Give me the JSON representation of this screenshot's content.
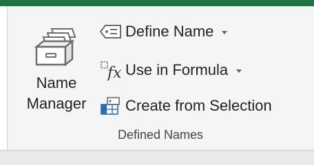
{
  "colors": {
    "accent": "#217346",
    "icon_blue": "#2b6cb0",
    "icon_gray": "#6b6b6b"
  },
  "ribbon_group": {
    "label": "Defined Names",
    "name_manager": {
      "label_line1": "Name",
      "label_line2": "Manager",
      "icon": "name-manager-icon"
    },
    "commands": [
      {
        "label": "Define Name",
        "icon": "define-name-tag-icon",
        "has_dropdown": true
      },
      {
        "label": "Use in Formula",
        "icon": "formula-fx-icon",
        "has_dropdown": true
      },
      {
        "label": "Create from Selection",
        "icon": "create-from-selection-icon",
        "has_dropdown": false
      }
    ]
  }
}
